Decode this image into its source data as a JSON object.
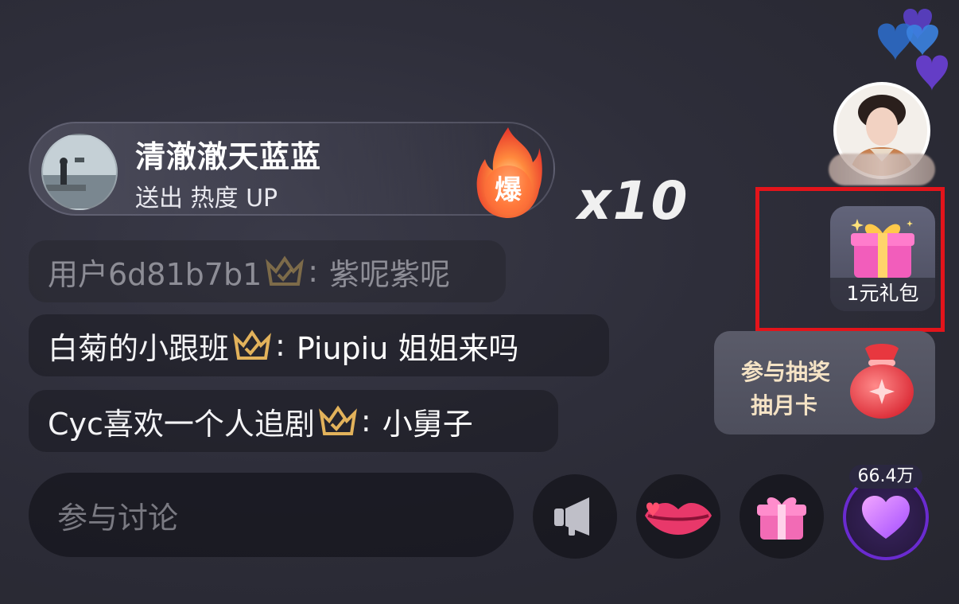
{
  "gift_banner": {
    "sender_name": "清澈澈天蓝蓝",
    "action_text": "送出 热度 UP",
    "badge_text": "爆",
    "combo": "x10"
  },
  "chat": [
    {
      "user": "用户6d81b7b1",
      "separator": ":",
      "text": "紫呢紫呢",
      "faded": true
    },
    {
      "user": "白菊的小跟班",
      "separator": ":",
      "text": "Piupiu 姐姐来吗",
      "faded": false
    },
    {
      "user": "Cyc喜欢一个人追剧",
      "separator": ":",
      "text": "小舅子",
      "faded": false
    }
  ],
  "side": {
    "gift_pack_label": "1元礼包",
    "lottery_line1": "参与抽奖",
    "lottery_line2": "抽月卡"
  },
  "bottom_bar": {
    "discuss_placeholder": "参与讨论",
    "like_count": "66.4万"
  },
  "icons": {
    "crown": "crown-badge-icon",
    "megaphone": "megaphone-icon",
    "lips": "lips-icon",
    "gift": "gift-icon",
    "heart": "heart-icon"
  },
  "colors": {
    "highlight": "#e3141b",
    "lottery_text": "#f5e3c5",
    "like_ring": "#6a2bd0"
  }
}
